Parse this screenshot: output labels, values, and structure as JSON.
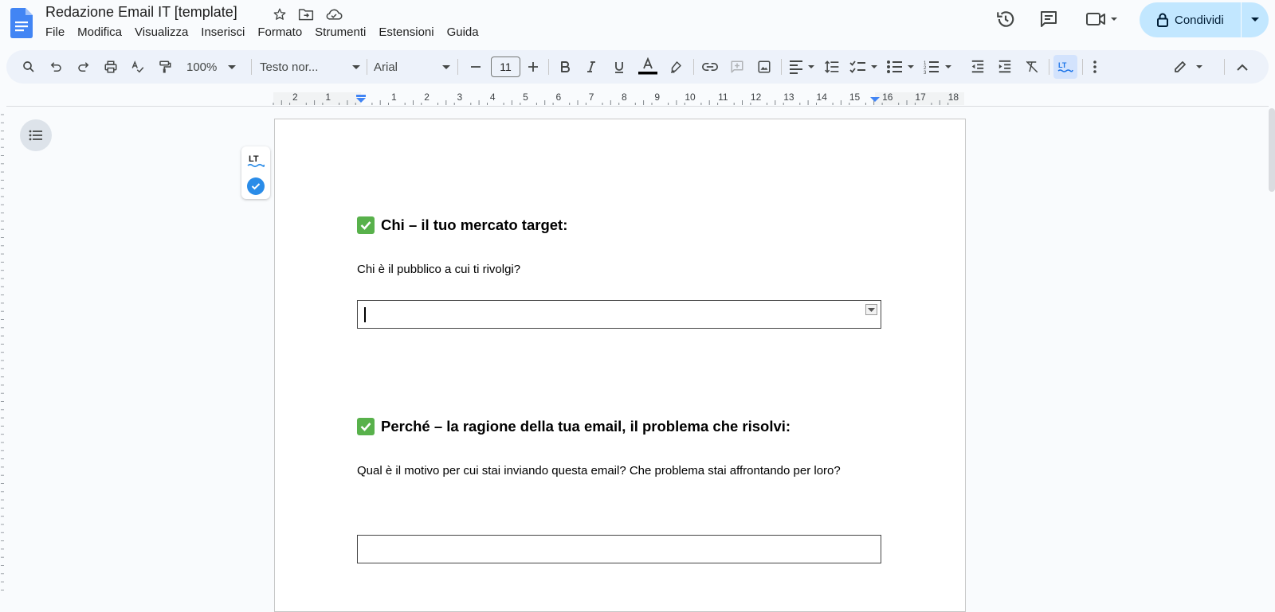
{
  "app": {
    "title": "Redazione Email IT [template]",
    "icons": [
      "docs-logo-icon",
      "star-icon",
      "move-folder-icon",
      "cloud-saved-icon"
    ]
  },
  "menu": [
    "File",
    "Modifica",
    "Visualizza",
    "Inserisci",
    "Formato",
    "Strumenti",
    "Estensioni",
    "Guida"
  ],
  "header_actions": {
    "share_label": "Condividi",
    "icons": [
      "version-history-icon",
      "comments-icon",
      "meet-video-icon",
      "lock-icon"
    ]
  },
  "toolbar": {
    "zoom": "100%",
    "style": "Testo nor...",
    "font": "Arial",
    "font_size": "11",
    "text_color": "#000000"
  },
  "ruler": {
    "labels_left": [
      "2",
      "1"
    ],
    "labels_right": [
      "1",
      "2",
      "3",
      "4",
      "5",
      "6",
      "7",
      "8",
      "9",
      "10",
      "11",
      "12",
      "13",
      "14",
      "15",
      "16",
      "17",
      "18"
    ]
  },
  "document": {
    "section1": {
      "heading": "Chi – il tuo mercato target:",
      "question": "Chi è il pubblico a cui ti rivolgi?",
      "answer": ""
    },
    "section2": {
      "heading": "Perché – la ragione della tua email, il problema che risolvi:",
      "question": "Qual è il motivo per cui stai inviando questa email? Che problema stai affrontando per loro?",
      "answer": ""
    }
  },
  "colors": {
    "accent": "#1a73e8",
    "share_bg": "#c2e7ff",
    "toolbar_bg": "#edf2fa",
    "check_green": "#58b14b"
  }
}
